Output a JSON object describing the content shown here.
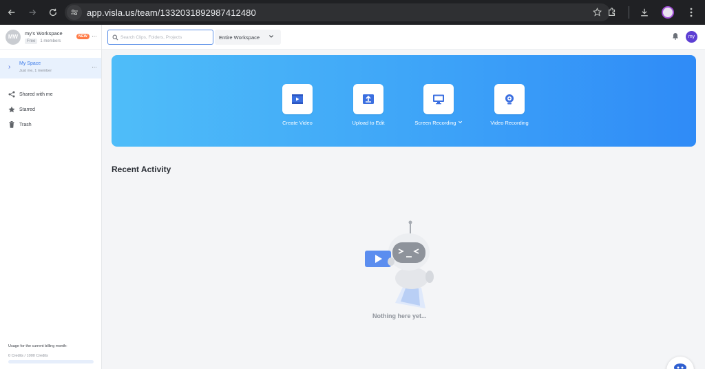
{
  "browser": {
    "url": "app.visla.us/team/1332031892987412480"
  },
  "workspace": {
    "avatar_initials": "MW",
    "name": "my's Workspace",
    "plan": "Free",
    "members": "1 members",
    "badge": "NEW",
    "more": "···"
  },
  "sidebar": {
    "space": {
      "title": "My Space",
      "subtitle": "Just me, 1 member",
      "more": "···"
    },
    "links": [
      {
        "label": "Shared with me",
        "icon": "share-icon"
      },
      {
        "label": "Starred",
        "icon": "star-icon"
      },
      {
        "label": "Trash",
        "icon": "trash-icon"
      }
    ],
    "usage": {
      "label": "Usage for the current billing month:",
      "value": "0 Credits / 1000 Credits",
      "fraction": 0
    }
  },
  "topbar": {
    "search_placeholder": "Search Clips, Folders, Projects",
    "scope": "Entire Workspace",
    "user_initials": "my"
  },
  "hero": {
    "actions": [
      {
        "label": "Create Video",
        "icon": "film-icon"
      },
      {
        "label": "Upload to Edit",
        "icon": "upload-icon"
      },
      {
        "label": "Screen Recording",
        "icon": "monitor-icon"
      },
      {
        "label": "Video Recording",
        "icon": "webcam-icon"
      }
    ]
  },
  "recent": {
    "title": "Recent Activity",
    "empty_text": "Nothing here yet..."
  },
  "colors": {
    "accent": "#3d7be8",
    "hero_start": "#4fbdf9",
    "hero_end": "#2f8bf7",
    "badge": "#ff7a45",
    "avatar": "#5d3fd3"
  }
}
